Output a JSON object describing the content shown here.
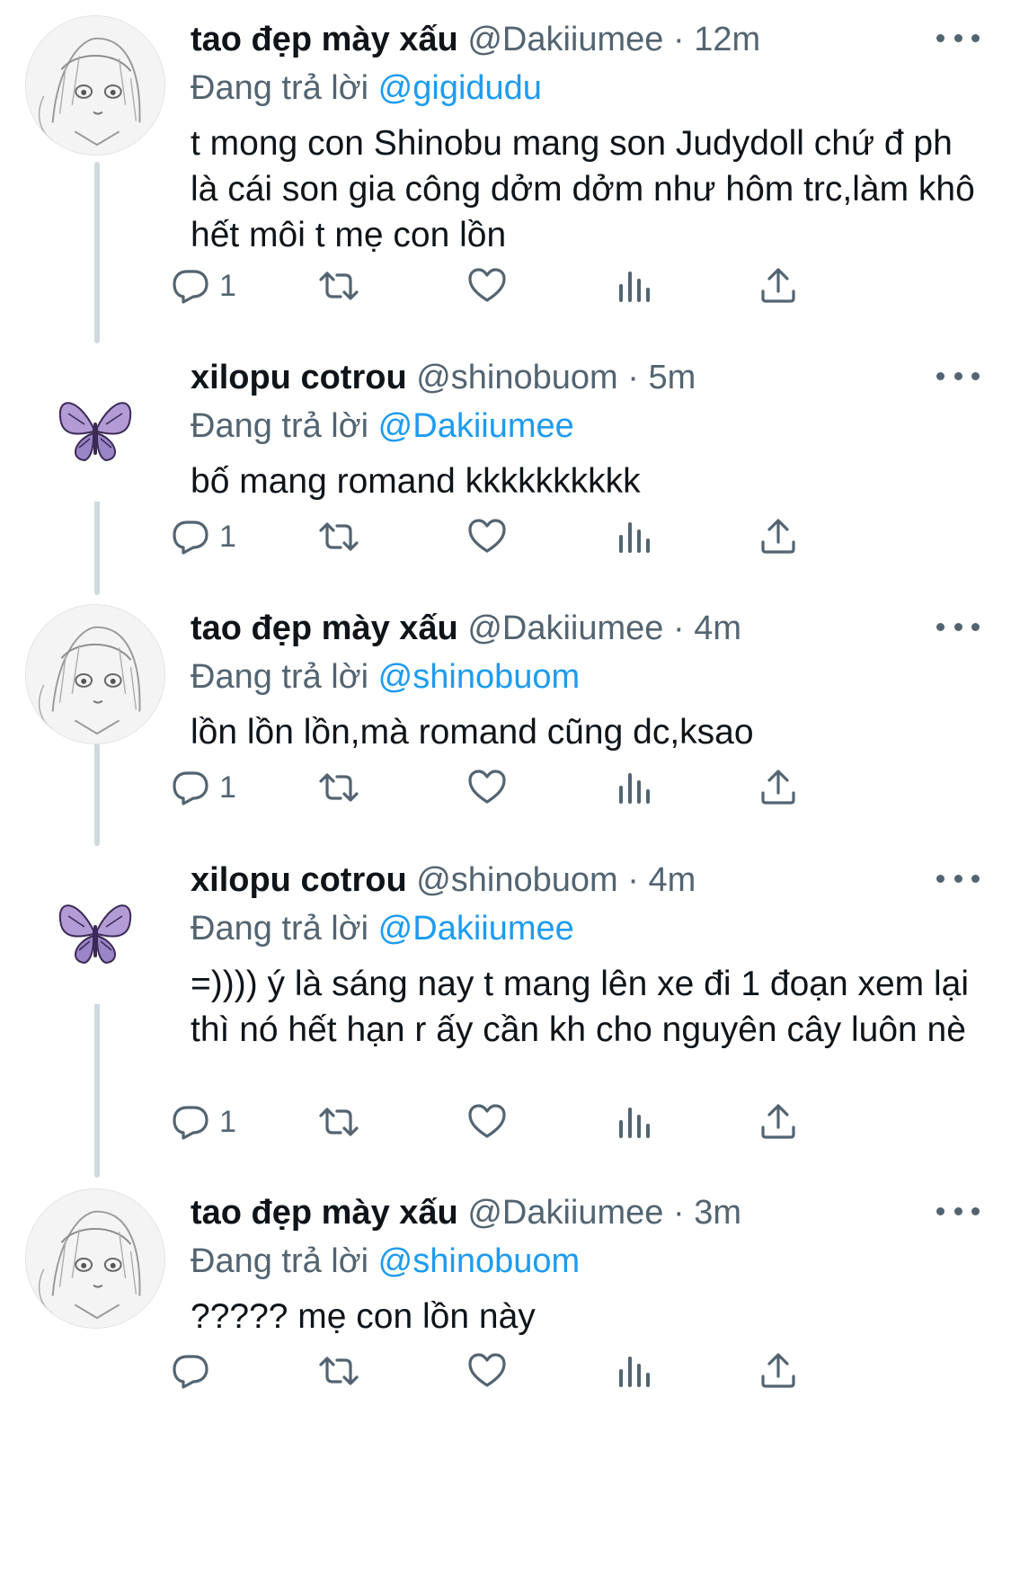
{
  "replying_label": "Đang trả lời",
  "tweets": [
    {
      "author_name": "tao đẹp mày xấu",
      "handle": "@Dakiiumee",
      "separator": "·",
      "time": "12m",
      "reply_to": "@gigidudu",
      "text": "t mong con Shinobu mang son Judydoll chứ đ ph là cái son gia công dởm dởm như hôm trc,làm khô hết môi t mẹ con lồn",
      "reply_count": "1",
      "avatar_icon": "sketch-avatar-icon"
    },
    {
      "author_name": "xilopu cotrou",
      "handle": "@shinobuom",
      "separator": "·",
      "time": "5m",
      "reply_to": "@Dakiiumee",
      "text": "bố mang romand kkkkkkkkkk",
      "reply_count": "1",
      "avatar_icon": "butterfly-icon"
    },
    {
      "author_name": "tao đẹp mày xấu",
      "handle": "@Dakiiumee",
      "separator": "·",
      "time": "4m",
      "reply_to": "@shinobuom",
      "text": "lồn lồn lồn,mà romand cũng dc,ksao",
      "reply_count": "1",
      "avatar_icon": "sketch-avatar-icon"
    },
    {
      "author_name": "xilopu cotrou",
      "handle": "@shinobuom",
      "separator": "·",
      "time": "4m",
      "reply_to": "@Dakiiumee",
      "text": "=)))) ý là sáng nay t mang lên xe đi 1 đoạn xem lại thì nó hết hạn r ấy cần kh cho nguyên cây luôn nè",
      "reply_count": "1",
      "avatar_icon": "butterfly-icon"
    },
    {
      "author_name": "tao đẹp mày xấu",
      "handle": "@Dakiiumee",
      "separator": "·",
      "time": "3m",
      "reply_to": "@shinobuom",
      "text": "????? mẹ con lồn này",
      "reply_count": "",
      "avatar_icon": "sketch-avatar-icon"
    }
  ],
  "colors": {
    "text": "#0f1419",
    "secondary": "#536471",
    "mention": "#1d9bf0",
    "thread_line": "#cfd9de"
  },
  "action_icons": [
    "reply-icon",
    "retweet-icon",
    "like-icon",
    "analytics-icon",
    "share-icon"
  ]
}
